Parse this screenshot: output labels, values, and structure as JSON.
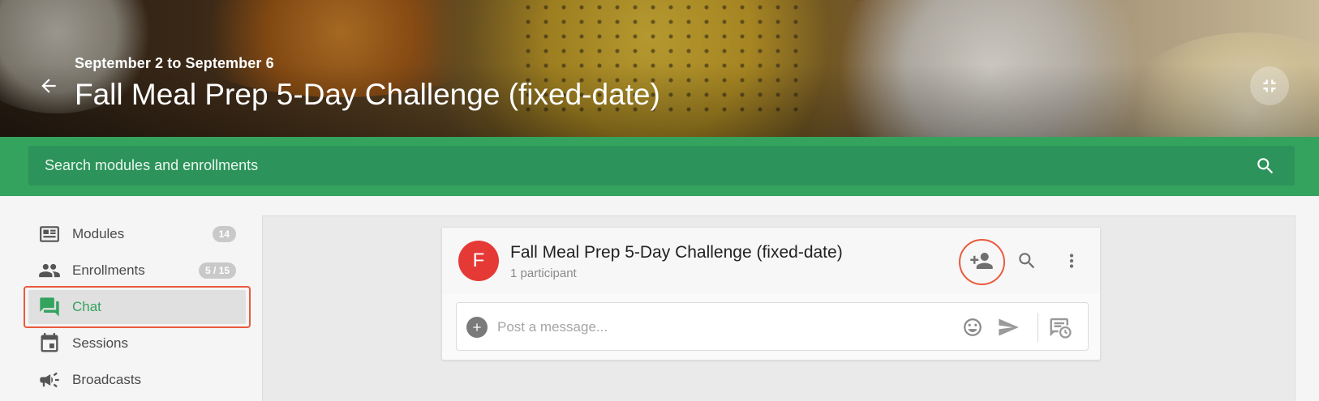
{
  "header": {
    "date_range": "September 2 to September 6",
    "title": "Fall Meal Prep 5-Day Challenge (fixed-date)",
    "back_icon": "arrow-left-icon",
    "collapse_icon": "collapse-icon"
  },
  "search": {
    "placeholder": "Search modules and enrollments",
    "icon": "search-icon"
  },
  "sidebar": {
    "items": [
      {
        "label": "Modules",
        "icon": "modules-icon",
        "badge": "14",
        "active": false
      },
      {
        "label": "Enrollments",
        "icon": "people-icon",
        "badge": "5 / 15",
        "active": false
      },
      {
        "label": "Chat",
        "icon": "chat-icon",
        "badge": "",
        "active": true
      },
      {
        "label": "Sessions",
        "icon": "calendar-icon",
        "badge": "",
        "active": false
      },
      {
        "label": "Broadcasts",
        "icon": "megaphone-icon",
        "badge": "",
        "active": false
      }
    ]
  },
  "chat": {
    "avatar_letter": "F",
    "title": "Fall Meal Prep 5-Day Challenge (fixed-date)",
    "subtitle": "1 participant",
    "composer_placeholder": "Post a message..."
  },
  "colors": {
    "brand_green": "#34a35d",
    "avatar_red": "#e53935",
    "highlight": "#ea5a3d"
  }
}
